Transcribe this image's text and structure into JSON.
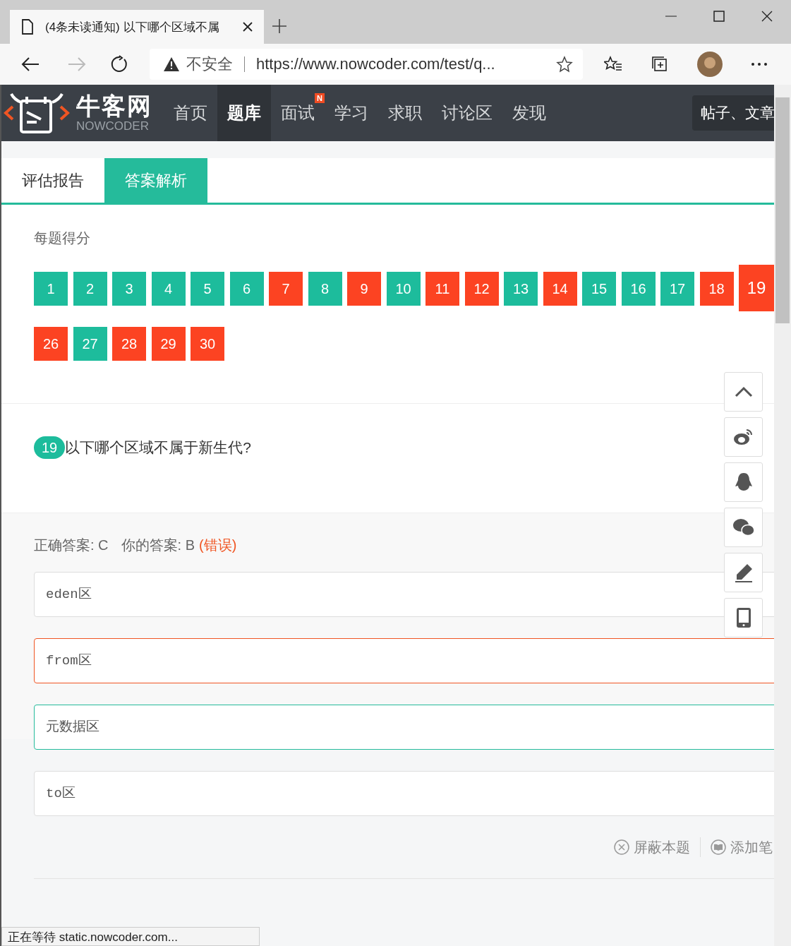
{
  "browser": {
    "tab_title": "(4条未读通知) 以下哪个区域不属",
    "security": "不安全",
    "url": "https://www.nowcoder.com/test/q..."
  },
  "site": {
    "logo": "牛客网",
    "logo_sub": "NOWCODER",
    "nav": [
      {
        "label": "首页",
        "selected": false
      },
      {
        "label": "题库",
        "selected": true
      },
      {
        "label": "面试",
        "selected": false,
        "badge": "N"
      },
      {
        "label": "学习",
        "selected": false
      },
      {
        "label": "求职",
        "selected": false
      },
      {
        "label": "讨论区",
        "selected": false
      },
      {
        "label": "发现",
        "selected": false
      }
    ],
    "search": "帖子、文章"
  },
  "tabs": [
    {
      "label": "评估报告",
      "selected": false
    },
    {
      "label": "答案解析",
      "selected": true
    }
  ],
  "score_title": "每题得分",
  "scores": [
    {
      "num": "1",
      "correct": true,
      "selected": false
    },
    {
      "num": "2",
      "correct": true,
      "selected": false
    },
    {
      "num": "3",
      "correct": true,
      "selected": false
    },
    {
      "num": "4",
      "correct": true,
      "selected": false
    },
    {
      "num": "5",
      "correct": true,
      "selected": false
    },
    {
      "num": "6",
      "correct": true,
      "selected": false
    },
    {
      "num": "7",
      "correct": false,
      "selected": false
    },
    {
      "num": "8",
      "correct": true,
      "selected": false
    },
    {
      "num": "9",
      "correct": false,
      "selected": false
    },
    {
      "num": "10",
      "correct": true,
      "selected": false
    },
    {
      "num": "11",
      "correct": false,
      "selected": false
    },
    {
      "num": "12",
      "correct": false,
      "selected": false
    },
    {
      "num": "13",
      "correct": true,
      "selected": false
    },
    {
      "num": "14",
      "correct": false,
      "selected": false
    },
    {
      "num": "15",
      "correct": true,
      "selected": false
    },
    {
      "num": "16",
      "correct": true,
      "selected": false
    },
    {
      "num": "17",
      "correct": true,
      "selected": false
    },
    {
      "num": "18",
      "correct": false,
      "selected": false
    },
    {
      "num": "19",
      "correct": false,
      "selected": true
    },
    {
      "num": "26",
      "correct": false,
      "selected": false
    },
    {
      "num": "27",
      "correct": true,
      "selected": false
    },
    {
      "num": "28",
      "correct": false,
      "selected": false
    },
    {
      "num": "29",
      "correct": false,
      "selected": false
    },
    {
      "num": "30",
      "correct": false,
      "selected": false
    }
  ],
  "question": {
    "num": "19",
    "text": "以下哪个区域不属于新生代?"
  },
  "answer": {
    "correct_label": "正确答案: C",
    "your_label": "你的答案: B",
    "verdict": "(错误)"
  },
  "options": [
    {
      "text": "eden区",
      "correct": false,
      "chosen": false
    },
    {
      "text": "from区",
      "correct": false,
      "chosen": true
    },
    {
      "text": "元数据区",
      "correct": true,
      "chosen": false
    },
    {
      "text": "to区",
      "correct": false,
      "chosen": false
    }
  ],
  "actions": [
    "屏蔽本题",
    "添加笔"
  ],
  "status_bar": "正在等待 static.nowcoder.com..."
}
